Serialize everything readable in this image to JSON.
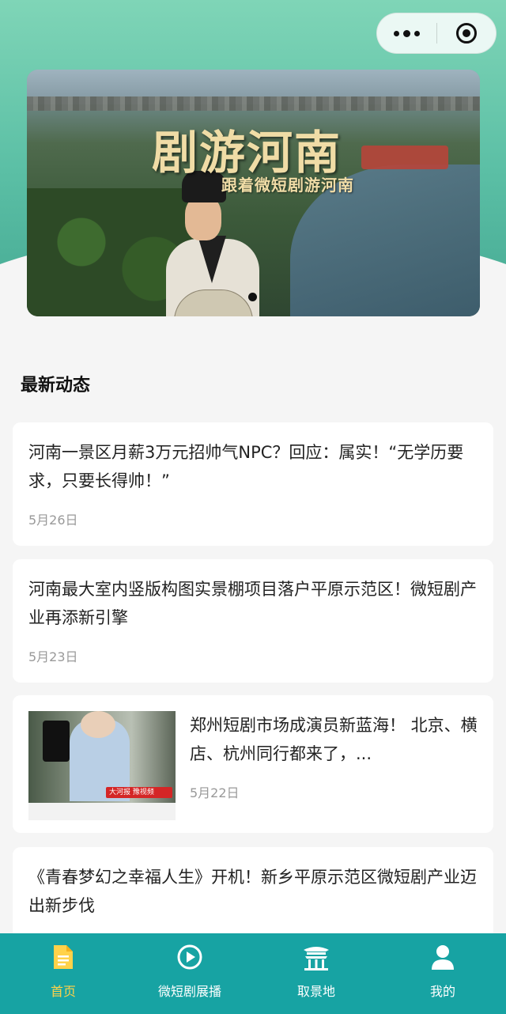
{
  "mini_program_capsule": {
    "more_icon": "more-dots-icon",
    "close_icon": "target-ring-icon"
  },
  "banner": {
    "title": "剧游河南",
    "subtitle": "跟着微短剧游河南"
  },
  "section": {
    "title": "最新动态"
  },
  "news": [
    {
      "headline": "河南一景区月薪3万元招帅气NPC？回应：属实！“无学历要求，只要长得帅！”",
      "date": "5月26日"
    },
    {
      "headline": "河南最大室内竖版构图实景棚项目落户平原示范区！微短剧产业再添新引擎",
      "date": "5月23日"
    },
    {
      "headline": "郑州短剧市场成演员新蓝海！ 北京、横店、杭州同行都来了，...",
      "date": "5月22日",
      "thumbnail_logo": "大河报 豫视频"
    },
    {
      "headline": "《青春梦幻之幸福人生》开机！新乡平原示范区微短剧产业迈出新步伐",
      "date": ""
    }
  ],
  "tabbar": {
    "active_color": "#ffd24a",
    "background": "#17a3a3",
    "tabs": [
      {
        "label": "首页",
        "icon": "document-icon"
      },
      {
        "label": "微短剧展播",
        "icon": "play-circle-icon"
      },
      {
        "label": "取景地",
        "icon": "pavilion-icon"
      },
      {
        "label": "我的",
        "icon": "user-icon"
      }
    ]
  }
}
